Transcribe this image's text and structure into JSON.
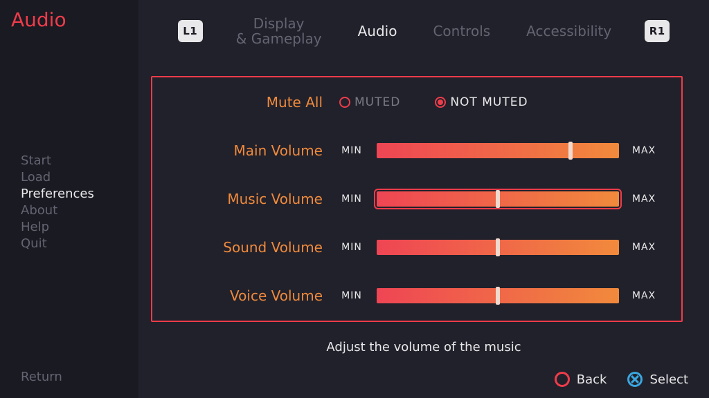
{
  "page_title": "Audio",
  "sidebar": {
    "items": [
      {
        "label": "Start"
      },
      {
        "label": "Load"
      },
      {
        "label": "Preferences"
      },
      {
        "label": "About"
      },
      {
        "label": "Help"
      },
      {
        "label": "Quit"
      }
    ],
    "active_index": 2,
    "return_label": "Return"
  },
  "bumpers": {
    "left": "L1",
    "right": "R1"
  },
  "tabs": {
    "items": [
      "Display\n& Gameplay",
      "Audio",
      "Controls",
      "Accessibility"
    ],
    "active_index": 1
  },
  "mute": {
    "label": "Mute All",
    "options": [
      {
        "label": "MUTED",
        "selected": false
      },
      {
        "label": "NOT MUTED",
        "selected": true
      }
    ]
  },
  "sliders": {
    "min_label": "MIN",
    "max_label": "MAX",
    "items": [
      {
        "id": "main",
        "label": "Main Volume",
        "value": 0.8,
        "highlight": false
      },
      {
        "id": "music",
        "label": "Music Volume",
        "value": 0.5,
        "highlight": true
      },
      {
        "id": "sound",
        "label": "Sound Volume",
        "value": 0.5,
        "highlight": false
      },
      {
        "id": "voice",
        "label": "Voice Volume",
        "value": 0.5,
        "highlight": false
      }
    ]
  },
  "hint": "Adjust the volume of the music",
  "footer": {
    "back_label": "Back",
    "select_label": "Select"
  }
}
